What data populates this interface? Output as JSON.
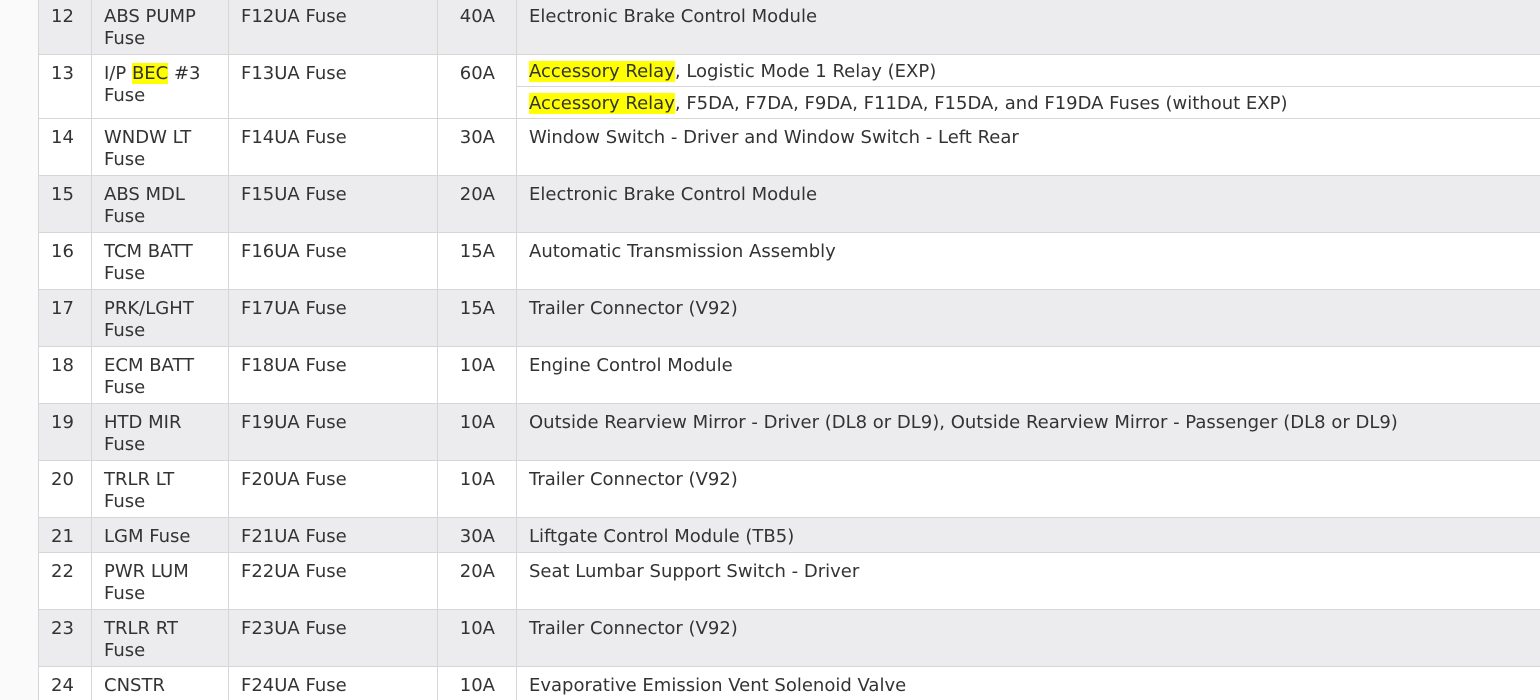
{
  "table": {
    "rows": [
      {
        "num": "12",
        "name": "ABS PUMP Fuse",
        "part": "F12UA Fuse",
        "amp": "40A",
        "circuit": "Electronic Brake Control Module",
        "shade": "gray"
      },
      {
        "num": "13",
        "name_pre": "I/P ",
        "name_hl": "BEC",
        "name_post": " #3 Fuse",
        "part": "F13UA Fuse",
        "amp": "60A",
        "circuits": [
          {
            "hl": "Accessory Relay",
            "rest": ", Logistic Mode 1 Relay (EXP)"
          },
          {
            "hl": "Accessory Relay",
            "rest": ", F5DA, F7DA, F9DA, F11DA, F15DA, and F19DA Fuses (without EXP)"
          }
        ],
        "shade": "white"
      },
      {
        "num": "14",
        "name": "WNDW LT Fuse",
        "part": "F14UA Fuse",
        "amp": "30A",
        "circuit": "Window Switch - Driver and Window Switch - Left Rear",
        "shade": "white"
      },
      {
        "num": "15",
        "name": "ABS MDL Fuse",
        "part": "F15UA Fuse",
        "amp": "20A",
        "circuit": "Electronic Brake Control Module",
        "shade": "gray"
      },
      {
        "num": "16",
        "name": "TCM BATT Fuse",
        "part": "F16UA Fuse",
        "amp": "15A",
        "circuit": "Automatic Transmission Assembly",
        "shade": "white"
      },
      {
        "num": "17",
        "name": "PRK/LGHT Fuse",
        "part": "F17UA Fuse",
        "amp": "15A",
        "circuit": "Trailer Connector (V92)",
        "shade": "gray"
      },
      {
        "num": "18",
        "name": "ECM BATT Fuse",
        "part": "F18UA Fuse",
        "amp": "10A",
        "circuit": "Engine Control Module",
        "shade": "white"
      },
      {
        "num": "19",
        "name": "HTD MIR Fuse",
        "part": "F19UA Fuse",
        "amp": "10A",
        "circuit": "Outside Rearview Mirror - Driver (DL8 or DL9), Outside Rearview Mirror - Passenger (DL8 or DL9)",
        "shade": "gray"
      },
      {
        "num": "20",
        "name": "TRLR LT Fuse",
        "part": "F20UA Fuse",
        "amp": "10A",
        "circuit": "Trailer Connector (V92)",
        "shade": "white"
      },
      {
        "num": "21",
        "name": "LGM Fuse",
        "part": "F21UA Fuse",
        "amp": "30A",
        "circuit": "Liftgate Control Module (TB5)",
        "shade": "gray"
      },
      {
        "num": "22",
        "name": "PWR LUM Fuse",
        "part": "F22UA Fuse",
        "amp": "20A",
        "circuit": "Seat Lumbar Support Switch - Driver",
        "shade": "white"
      },
      {
        "num": "23",
        "name": "TRLR RT Fuse",
        "part": "F23UA Fuse",
        "amp": "10A",
        "circuit": "Trailer Connector (V92)",
        "shade": "gray"
      },
      {
        "num": "24",
        "name": "CNSTR",
        "part": "F24UA Fuse",
        "amp": "10A",
        "circuit": "Evaporative Emission Vent Solenoid Valve",
        "shade": "white"
      }
    ]
  }
}
